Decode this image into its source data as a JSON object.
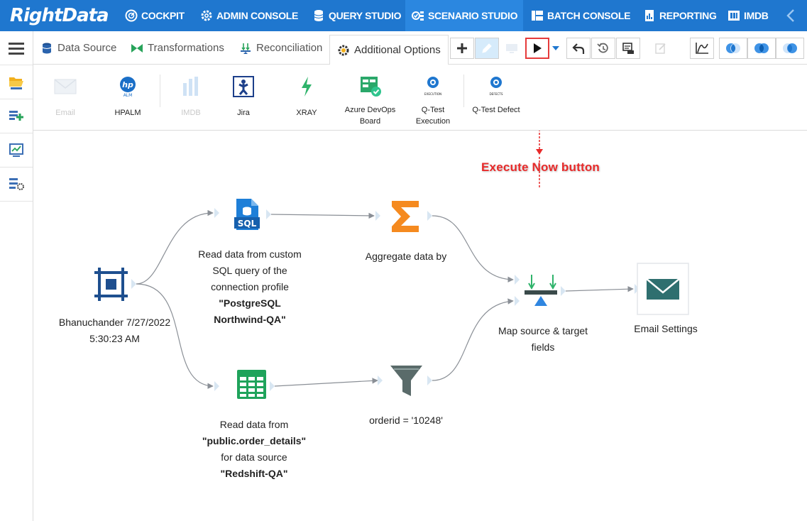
{
  "nav": {
    "logo": "RightData",
    "items": [
      {
        "label": "COCKPIT",
        "icon": "speedometer-icon",
        "active": false
      },
      {
        "label": "ADMIN CONSOLE",
        "icon": "gear-icon",
        "active": false
      },
      {
        "label": "QUERY STUDIO",
        "icon": "database-icon",
        "active": false
      },
      {
        "label": "SCENARIO STUDIO",
        "icon": "scenario-icon",
        "active": true
      },
      {
        "label": "BATCH CONSOLE",
        "icon": "batch-icon",
        "active": false
      },
      {
        "label": "REPORTING",
        "icon": "report-icon",
        "active": false
      },
      {
        "label": "IMDB",
        "icon": "imdb-icon",
        "active": false
      }
    ]
  },
  "tabs": [
    {
      "label": "Data Source",
      "icon": "database-icon"
    },
    {
      "label": "Transformations",
      "icon": "bowtie-icon"
    },
    {
      "label": "Reconciliation",
      "icon": "reconcile-icon"
    },
    {
      "label": "Additional Options",
      "icon": "gear-icon",
      "active": true
    }
  ],
  "integrations": [
    {
      "label": "Email",
      "icon": "email-icon",
      "disabled": true
    },
    {
      "label": "HPALM",
      "icon": "hp-alm-icon",
      "disabled": false
    },
    {
      "label": "IMDB",
      "icon": "imdb-bars-icon",
      "disabled": true
    },
    {
      "label": "Jira",
      "icon": "jira-icon",
      "disabled": false
    },
    {
      "label": "XRAY",
      "icon": "xray-icon",
      "disabled": false
    },
    {
      "label": "Azure DevOps Board",
      "icon": "azure-devops-icon",
      "disabled": false
    },
    {
      "label": "Q-Test Execution",
      "icon": "qtest-execution-icon",
      "disabled": false,
      "icon_text": "EXECUTION"
    },
    {
      "label": "Q-Test Defect",
      "icon": "qtest-defect-icon",
      "disabled": false,
      "icon_text": "DEFECTS"
    }
  ],
  "flow": {
    "start_node": {
      "line1": "Bhanuchander 7/27/2022",
      "line2": "5:30:23 AM"
    },
    "sql_node": {
      "line1": "Read data from custom",
      "line2": "SQL query of the",
      "line3": "connection profile",
      "line4": "\"PostgreSQL",
      "line5": "Northwind-QA\"",
      "icon_text": "SQL"
    },
    "table_node": {
      "line1": "Read data from",
      "line2": "\"public.order_details\"",
      "line3": "for data source",
      "line4": "\"Redshift-QA\""
    },
    "aggregate_node": {
      "label": "Aggregate data by"
    },
    "filter_node": {
      "label": "orderid = '10248'"
    },
    "map_node": {
      "line1": "Map source & target",
      "line2": "fields"
    },
    "email_node": {
      "label": "Email Settings"
    }
  },
  "annotation": {
    "text": "Execute Now button",
    "color": "#e82a2a"
  },
  "colors": {
    "nav": "#1f77cf",
    "nav_active": "#2b87e0",
    "accent": "#1f77cf",
    "sigma": "#f58a1f",
    "green": "#27a35a"
  }
}
